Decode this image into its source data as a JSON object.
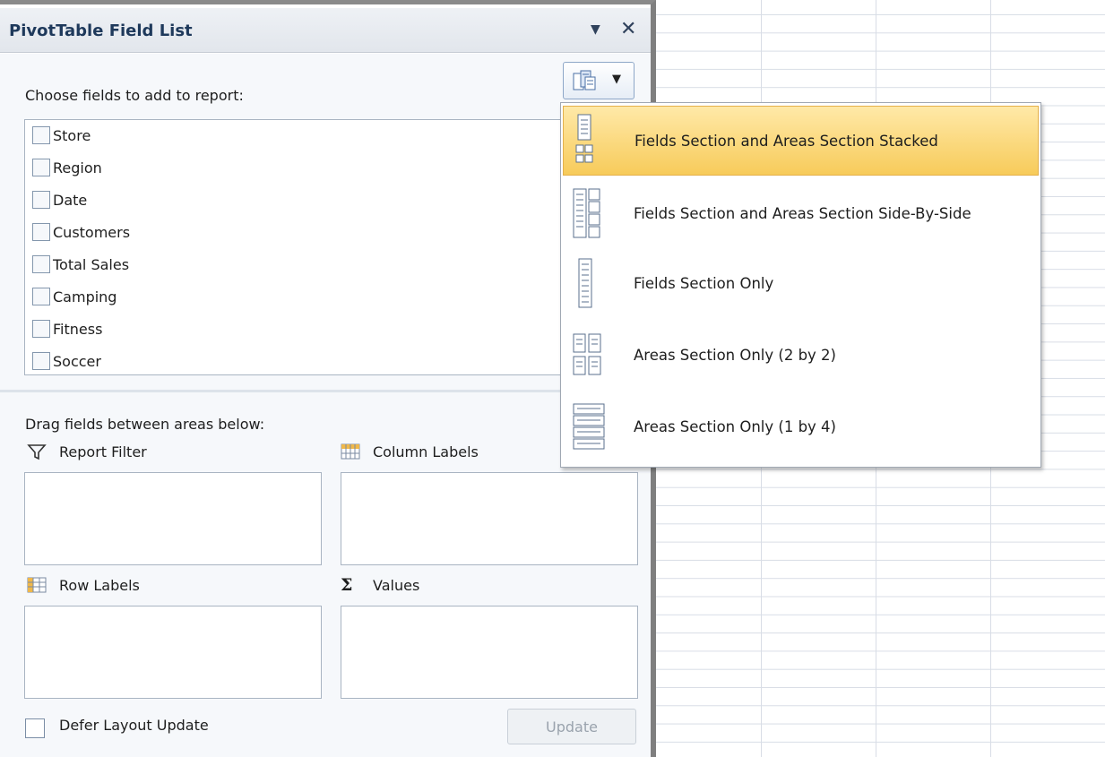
{
  "pane": {
    "title": "PivotTable Field List",
    "menu_arrow": "▼",
    "close": "✕",
    "choose_label": "Choose fields to add to report:",
    "fields": [
      "Store",
      "Region",
      "Date",
      "Customers",
      "Total Sales",
      "Camping",
      "Fitness",
      "Soccer"
    ],
    "drag_label": "Drag fields between areas below:",
    "areas": {
      "report_filter": "Report Filter",
      "column_labels": "Column Labels",
      "row_labels": "Row Labels",
      "values": "Values",
      "values_symbol": "Σ"
    },
    "defer_label": "Defer Layout Update",
    "update_label": "Update"
  },
  "layout_button": {
    "dropdown": "▼",
    "icon": "layout-icon"
  },
  "menu": {
    "items": [
      {
        "label": "Fields Section and Areas Section Stacked",
        "icon": "stacked-layout-icon",
        "selected": true
      },
      {
        "label": "Fields Section and Areas Section Side-By-Side",
        "icon": "side-by-side-layout-icon",
        "selected": false
      },
      {
        "label": "Fields Section Only",
        "icon": "fields-only-icon",
        "selected": false
      },
      {
        "label": "Areas Section Only (2 by 2)",
        "icon": "areas-2by2-icon",
        "selected": false
      },
      {
        "label": "Areas Section Only (1 by 4)",
        "icon": "areas-1by4-icon",
        "selected": false
      }
    ]
  },
  "colors": {
    "selection": "#f7cb5a",
    "header_text": "#1e395b",
    "pane_border": "#7f7f7f"
  }
}
